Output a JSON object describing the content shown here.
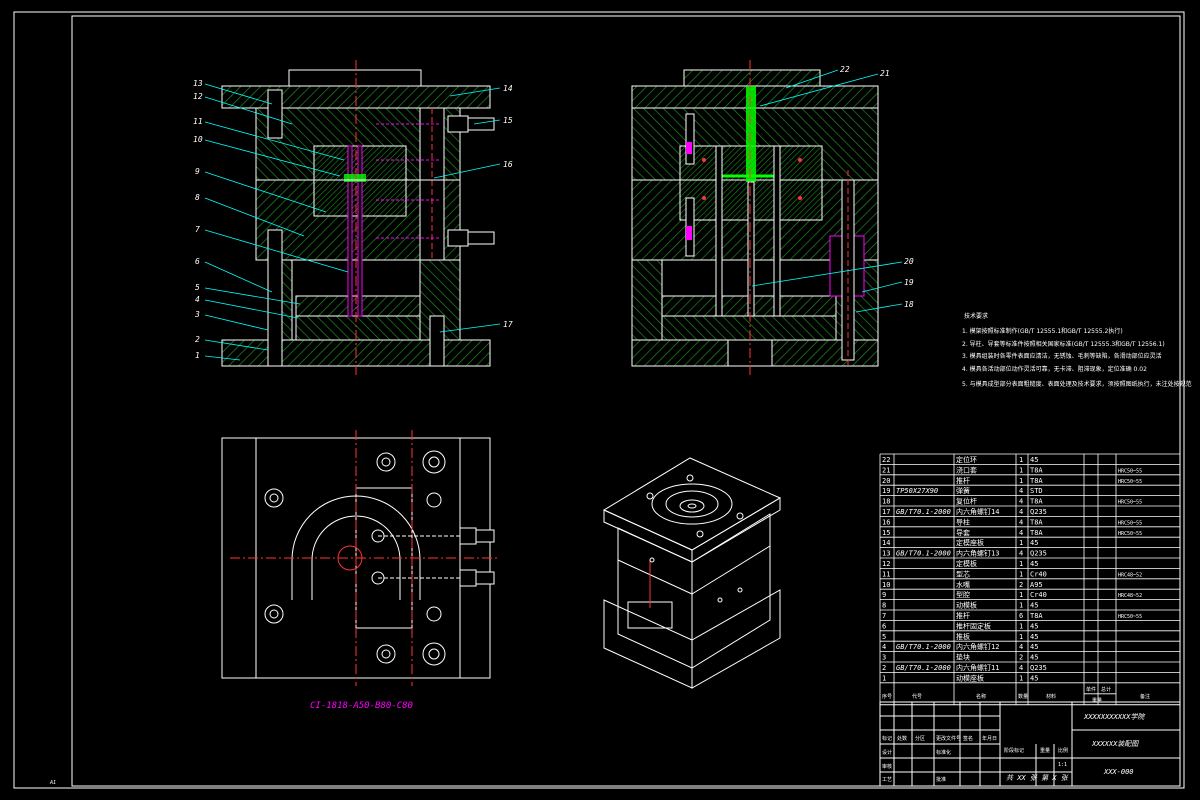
{
  "colors": {
    "background": "#000000",
    "line": "#ffffff",
    "hatch": "#00a800",
    "centerline": "#ff0000",
    "leader": "#00ffff",
    "pin": "#ff00ff",
    "gate": "#00ff00",
    "text_magenta": "#ff00ff"
  },
  "front_view": {
    "labels": [
      "1",
      "2",
      "3",
      "4",
      "5",
      "6",
      "7",
      "8",
      "9",
      "10",
      "11",
      "12",
      "13",
      "14",
      "15",
      "16",
      "17"
    ]
  },
  "side_view": {
    "labels": [
      "18",
      "19",
      "20",
      "21",
      "22"
    ]
  },
  "plan_view": {
    "caption": "CI-1818-A50-B80-C80"
  },
  "tech_notes": {
    "title": "技术要求",
    "items": [
      "1. 模架按照标准制作(GB/T 12555.1和GB/T 12555.2执行)",
      "2. 导柱、导套等标准件按照相关国家标准(GB/T 12555.3和GB/T 12556.1)",
      "3. 模具组装时各零件表面应清洁，无锈蚀、毛刺等缺陷，各滑动部位应灵活",
      "4. 模具各活动部位动作灵活可靠，无卡滞、阻滞现象，定位准确 0.02",
      "5. 与模具成型部分表面粗糙度、表面处理及技术要求，须按照图纸执行，未注处按规范"
    ]
  },
  "bom": {
    "rows": [
      {
        "no": "22",
        "code": "",
        "name": "定位环",
        "qty": "1",
        "mat": "45",
        "note": ""
      },
      {
        "no": "21",
        "code": "",
        "name": "浇口套",
        "qty": "1",
        "mat": "T8A",
        "note": "HRC50~55"
      },
      {
        "no": "20",
        "code": "",
        "name": "推杆",
        "qty": "1",
        "mat": "T8A",
        "note": "HRC50~55"
      },
      {
        "no": "19",
        "code": "TP50X27X90",
        "name": "弹簧",
        "qty": "4",
        "mat": "STD",
        "note": ""
      },
      {
        "no": "18",
        "code": "",
        "name": "复位杆",
        "qty": "4",
        "mat": "T8A",
        "note": "HRC50~55"
      },
      {
        "no": "17",
        "code": "GB/T70.1-2000",
        "name": "内六角螺钉14",
        "qty": "4",
        "mat": "Q235",
        "note": ""
      },
      {
        "no": "16",
        "code": "",
        "name": "导柱",
        "qty": "4",
        "mat": "T8A",
        "note": "HRC50~55"
      },
      {
        "no": "15",
        "code": "",
        "name": "导套",
        "qty": "4",
        "mat": "T8A",
        "note": "HRC50~55"
      },
      {
        "no": "14",
        "code": "",
        "name": "定模座板",
        "qty": "1",
        "mat": "45",
        "note": ""
      },
      {
        "no": "13",
        "code": "GB/T70.1-2000",
        "name": "内六角螺钉13",
        "qty": "4",
        "mat": "Q235",
        "note": ""
      },
      {
        "no": "12",
        "code": "",
        "name": "定模板",
        "qty": "1",
        "mat": "45",
        "note": ""
      },
      {
        "no": "11",
        "code": "",
        "name": "型芯",
        "qty": "1",
        "mat": "Cr40",
        "note": "HRC48~52"
      },
      {
        "no": "10",
        "code": "",
        "name": "水嘴",
        "qty": "2",
        "mat": "A95",
        "note": ""
      },
      {
        "no": "9",
        "code": "",
        "name": "型腔",
        "qty": "1",
        "mat": "Cr40",
        "note": "HRC48~52"
      },
      {
        "no": "8",
        "code": "",
        "name": "动模板",
        "qty": "1",
        "mat": "45",
        "note": ""
      },
      {
        "no": "7",
        "code": "",
        "name": "推杆",
        "qty": "6",
        "mat": "T8A",
        "note": "HRC50~55"
      },
      {
        "no": "6",
        "code": "",
        "name": "推杆固定板",
        "qty": "1",
        "mat": "45",
        "note": ""
      },
      {
        "no": "5",
        "code": "",
        "name": "推板",
        "qty": "1",
        "mat": "45",
        "note": ""
      },
      {
        "no": "4",
        "code": "GB/T70.1-2000",
        "name": "内六角螺钉12",
        "qty": "4",
        "mat": "45",
        "note": ""
      },
      {
        "no": "3",
        "code": "",
        "name": "垫块",
        "qty": "2",
        "mat": "45",
        "note": ""
      },
      {
        "no": "2",
        "code": "GB/T70.1-2000",
        "name": "内六角螺钉11",
        "qty": "4",
        "mat": "Q235",
        "note": ""
      },
      {
        "no": "1",
        "code": "",
        "name": "动模座板",
        "qty": "1",
        "mat": "45",
        "note": ""
      }
    ],
    "header": {
      "no": "序号",
      "code": "代号",
      "name": "名称",
      "qty": "数量",
      "mat": "材料",
      "w1": "单件",
      "w2": "总计",
      "note": "备注",
      "weight": "重量"
    }
  },
  "title_block": {
    "school": "XXXXXXXXXXX学院",
    "drawing_name": "XXXXXX装配图",
    "drawing_no": "XXX-000",
    "sheet_info": "共 XX 张  第 X 张",
    "scale": "1:1",
    "stage_label": "阶段标记",
    "weight_label": "重量",
    "scale_label": "比例",
    "mark_cells": [
      "标记",
      "处数",
      "分区",
      "更改文件号",
      "签名",
      "年月日"
    ],
    "role_cells": [
      "设计",
      "标准化",
      "审核",
      "工艺",
      "批准"
    ]
  },
  "corner_mark": "A1"
}
